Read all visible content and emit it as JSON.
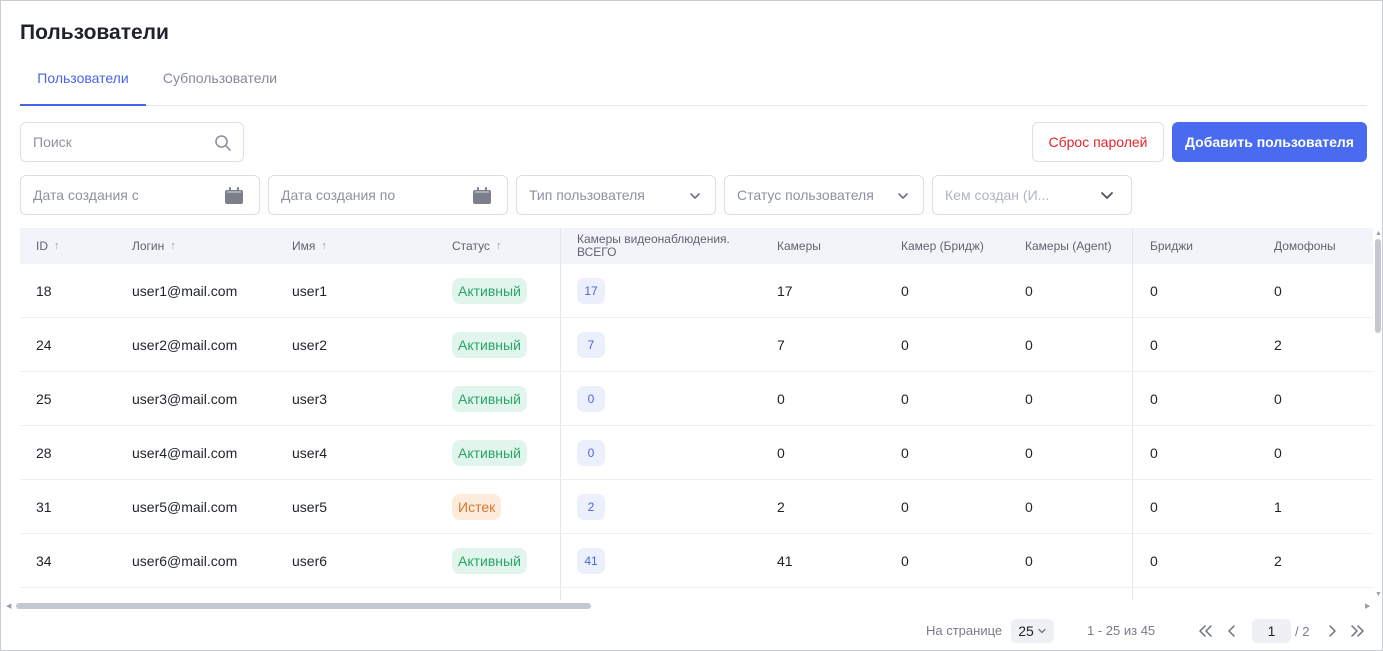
{
  "page": {
    "title": "Пользователи"
  },
  "tabs": [
    {
      "label": "Пользователи",
      "active": true
    },
    {
      "label": "Субпользователи",
      "active": false
    }
  ],
  "search": {
    "placeholder": "Поиск",
    "icon": "search-icon"
  },
  "filters": {
    "date_from": {
      "placeholder": "Дата создания с",
      "icon": "calendar-icon"
    },
    "date_to": {
      "placeholder": "Дата создания по",
      "icon": "calendar-icon"
    },
    "user_type": {
      "placeholder": "Тип пользователя",
      "icon": "chevron-down-icon"
    },
    "user_status": {
      "placeholder": "Статус пользователя",
      "icon": "chevron-down-icon"
    },
    "created_by": {
      "placeholder": "Кем создан (И...",
      "icon": "chevron-down-icon"
    }
  },
  "actions": {
    "reset_passwords": "Сброс паролей",
    "add_user": "Добавить пользователя"
  },
  "table": {
    "columns": [
      {
        "label": "ID",
        "sortable": true
      },
      {
        "label": "Логин",
        "sortable": true
      },
      {
        "label": "Имя",
        "sortable": true
      },
      {
        "label": "Статус",
        "sortable": true
      },
      {
        "label": "Камеры видеонаблюдения. ВСЕГО",
        "label_line1": "Камеры видеонаблюдения.",
        "label_line2": "ВСЕГО",
        "sortable": false
      },
      {
        "label": "Камеры",
        "sortable": false
      },
      {
        "label": "Камер (Бридж)",
        "sortable": false
      },
      {
        "label": "Камеры (Agent)",
        "sortable": false
      },
      {
        "label": "Бриджи",
        "sortable": false
      },
      {
        "label": "Домофоны",
        "sortable": false
      }
    ],
    "rows": [
      {
        "id": "18",
        "login": "user1@mail.com",
        "name": "user1",
        "status": "Активный",
        "status_type": "active",
        "cams_total": "17",
        "cams": "17",
        "cams_bridge": "0",
        "cams_agent": "0",
        "bridges": "0",
        "intercoms": "0"
      },
      {
        "id": "24",
        "login": "user2@mail.com",
        "name": "user2",
        "status": "Активный",
        "status_type": "active",
        "cams_total": "7",
        "cams": "7",
        "cams_bridge": "0",
        "cams_agent": "0",
        "bridges": "0",
        "intercoms": "2"
      },
      {
        "id": "25",
        "login": "user3@mail.com",
        "name": "user3",
        "status": "Активный",
        "status_type": "active",
        "cams_total": "0",
        "cams": "0",
        "cams_bridge": "0",
        "cams_agent": "0",
        "bridges": "0",
        "intercoms": "0"
      },
      {
        "id": "28",
        "login": "user4@mail.com",
        "name": "user4",
        "status": "Активный",
        "status_type": "active",
        "cams_total": "0",
        "cams": "0",
        "cams_bridge": "0",
        "cams_agent": "0",
        "bridges": "0",
        "intercoms": "0"
      },
      {
        "id": "31",
        "login": "user5@mail.com",
        "name": "user5",
        "status": "Истек",
        "status_type": "expired",
        "cams_total": "2",
        "cams": "2",
        "cams_bridge": "0",
        "cams_agent": "0",
        "bridges": "0",
        "intercoms": "1"
      },
      {
        "id": "34",
        "login": "user6@mail.com",
        "name": "user6",
        "status": "Активный",
        "status_type": "active",
        "cams_total": "41",
        "cams": "41",
        "cams_bridge": "0",
        "cams_agent": "0",
        "bridges": "0",
        "intercoms": "2"
      }
    ]
  },
  "pagination": {
    "per_page_label": "На странице",
    "per_page": "25",
    "range": "1 - 25 из 45",
    "current_page": "1",
    "total_pages": "/ 2"
  },
  "colors": {
    "accent": "#4a6bf0",
    "danger": "#e0262c",
    "status_active_bg": "#e2f5ec",
    "status_active_text": "#28a46a",
    "status_expired_bg": "#fdebdc",
    "status_expired_text": "#d8762f"
  }
}
